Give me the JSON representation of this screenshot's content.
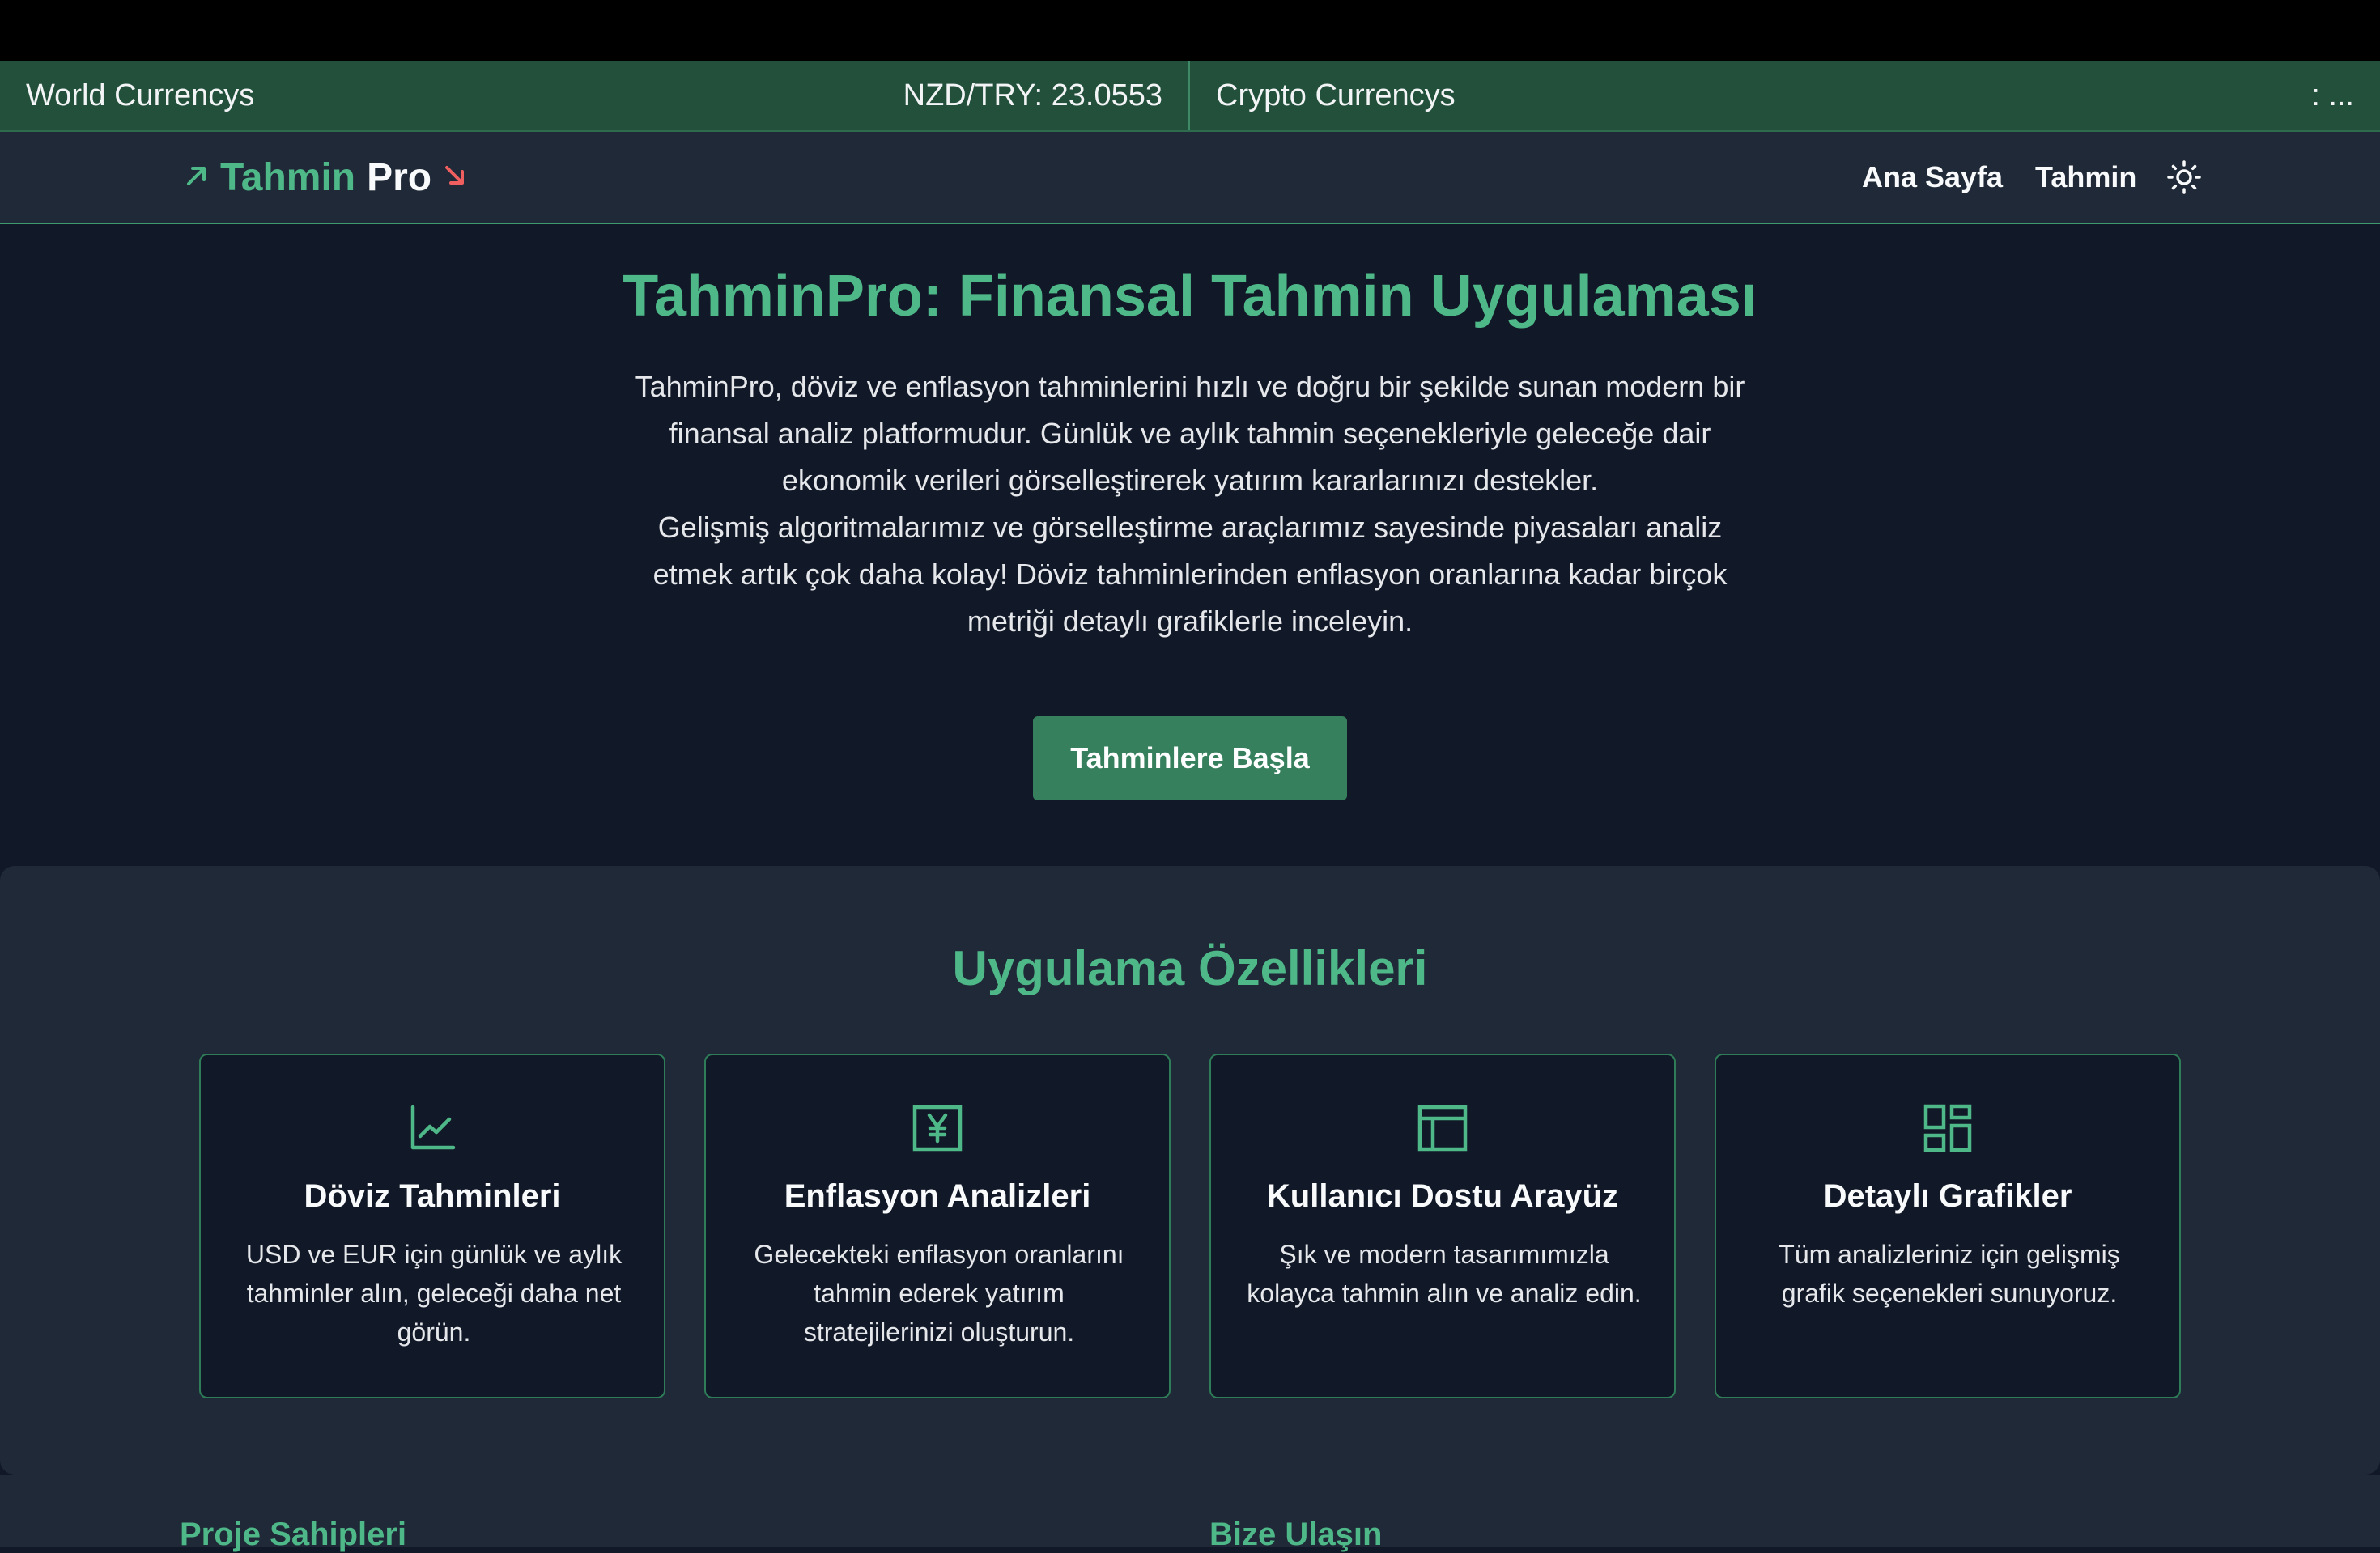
{
  "ticker": {
    "world_label": "World Currencys",
    "world_value": "NZD/TRY: 23.0553",
    "crypto_label": "Crypto Currencys",
    "crypto_value": ": ..."
  },
  "navbar": {
    "brand_part1": "Tahmin",
    "brand_part2": "Pro",
    "brand_up_icon": "arrow-up-right-icon",
    "brand_down_icon": "arrow-down-right-icon",
    "links": [
      {
        "label": "Ana Sayfa"
      },
      {
        "label": "Tahmin"
      }
    ],
    "theme_icon": "sun-icon"
  },
  "hero": {
    "title": "TahminPro: Finansal Tahmin Uygulaması",
    "paragraph_1": "TahminPro, döviz ve enflasyon tahminlerini hızlı ve doğru bir şekilde sunan modern bir finansal analiz platformudur. Günlük ve aylık tahmin seçenekleriyle geleceğe dair ekonomik verileri görselleştirerek yatırım kararlarınızı destekler.",
    "paragraph_2": "Gelişmiş algoritmalarımız ve görselleştirme araçlarımız sayesinde piyasaları analiz etmek artık çok daha kolay! Döviz tahminlerinden enflasyon oranlarına kadar birçok metriği detaylı grafiklerle inceleyin.",
    "button_label": "Tahminlere Başla"
  },
  "features": {
    "title": "Uygulama Özellikleri",
    "cards": [
      {
        "icon": "line-chart-icon",
        "title": "Döviz Tahminleri",
        "text": "USD ve EUR için günlük ve aylık tahminler alın, geleceği daha net görün."
      },
      {
        "icon": "currency-yen-icon",
        "title": "Enflasyon Analizleri",
        "text": "Gelecekteki enflasyon oranlarını tahmin ederek yatırım stratejilerinizi oluşturun."
      },
      {
        "icon": "layout-icon",
        "title": "Kullanıcı Dostu Arayüz",
        "text": "Şık ve modern tasarımımızla kolayca tahmin alın ve analiz edin."
      },
      {
        "icon": "dashboard-icon",
        "title": "Detaylı Grafikler",
        "text": "Tüm analizleriniz için gelişmiş grafik seçenekleri sunuyoruz."
      }
    ]
  },
  "footer": {
    "owners_title": "Proje Sahipleri",
    "contact_title": "Bize Ulaşın"
  },
  "colors": {
    "accent": "#4fb889",
    "button": "#37805e",
    "ticker_bg": "#22503b",
    "page_bg": "#111827",
    "panel_bg": "#1f2937",
    "down_arrow": "#ef5f5f"
  }
}
